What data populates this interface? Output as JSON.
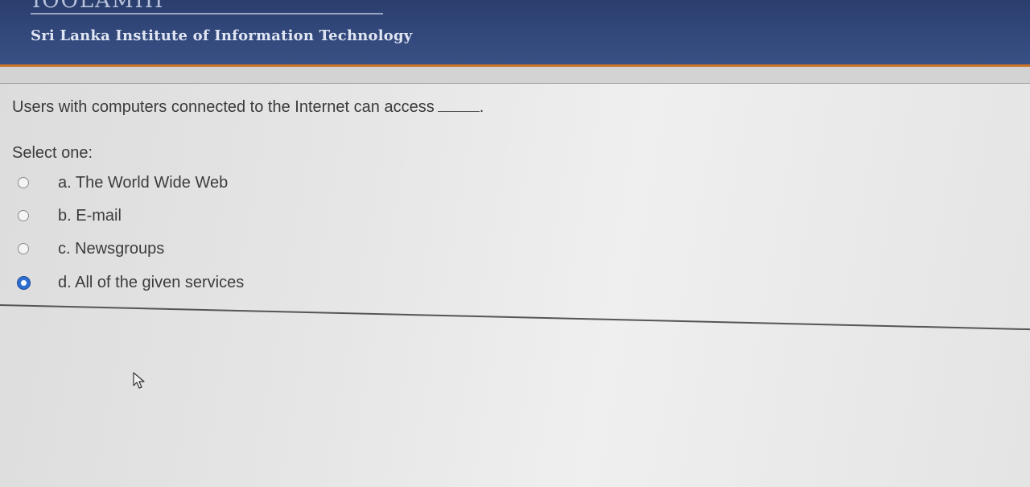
{
  "header": {
    "institution": "Sri Lanka Institute of Information Technology",
    "top_glyphs": "IOOLAMIII",
    "colors": {
      "banner": "#33497c",
      "accent": "#c9742a",
      "text": "#dfe5f2"
    }
  },
  "quiz": {
    "question": "Users with computers connected to the Internet can access",
    "question_tail": ".",
    "prompt": "Select one:",
    "options": [
      {
        "label": "a. The World Wide Web",
        "selected": false
      },
      {
        "label": "b. E-mail",
        "selected": false
      },
      {
        "label": "c. Newsgroups",
        "selected": false
      },
      {
        "label": "d. All of the given services",
        "selected": true
      }
    ],
    "selected_color": "#2f6fd1"
  },
  "cursor": {
    "icon": "mouse-pointer-icon"
  }
}
